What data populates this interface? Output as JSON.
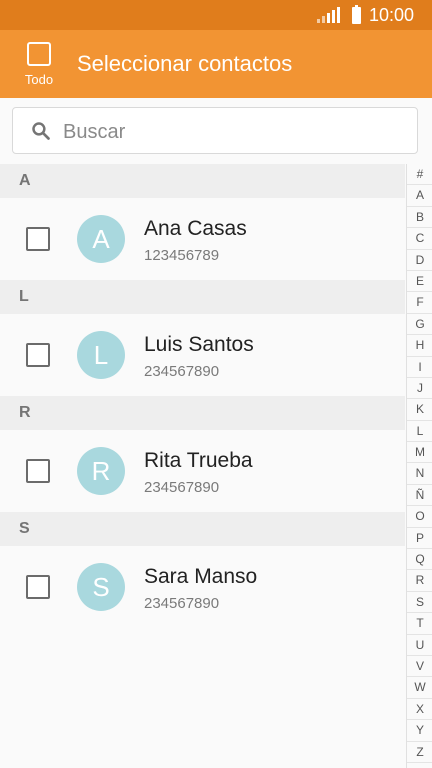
{
  "status_bar": {
    "time": "10:00"
  },
  "app_bar": {
    "select_all_label": "Todo",
    "title": "Seleccionar contactos"
  },
  "search": {
    "placeholder": "Buscar",
    "value": ""
  },
  "sections": [
    {
      "letter": "A",
      "contact": {
        "initial": "A",
        "name": "Ana Casas",
        "number": "123456789"
      }
    },
    {
      "letter": "L",
      "contact": {
        "initial": "L",
        "name": "Luis Santos",
        "number": "234567890"
      }
    },
    {
      "letter": "R",
      "contact": {
        "initial": "R",
        "name": "Rita Trueba",
        "number": "234567890"
      }
    },
    {
      "letter": "S",
      "contact": {
        "initial": "S",
        "name": "Sara Manso",
        "number": "234567890"
      }
    }
  ],
  "index": [
    "#",
    "A",
    "B",
    "C",
    "D",
    "E",
    "F",
    "G",
    "H",
    "I",
    "J",
    "K",
    "L",
    "M",
    "N",
    "Ñ",
    "O",
    "P",
    "Q",
    "R",
    "S",
    "T",
    "U",
    "V",
    "W",
    "X",
    "Y",
    "Z"
  ],
  "colors": {
    "status_bar": "#e07d1c",
    "app_bar": "#f29433",
    "avatar": "#a9d8de"
  },
  "icons": {
    "search": "search-icon",
    "signal": "signal-icon",
    "battery": "battery-icon"
  }
}
